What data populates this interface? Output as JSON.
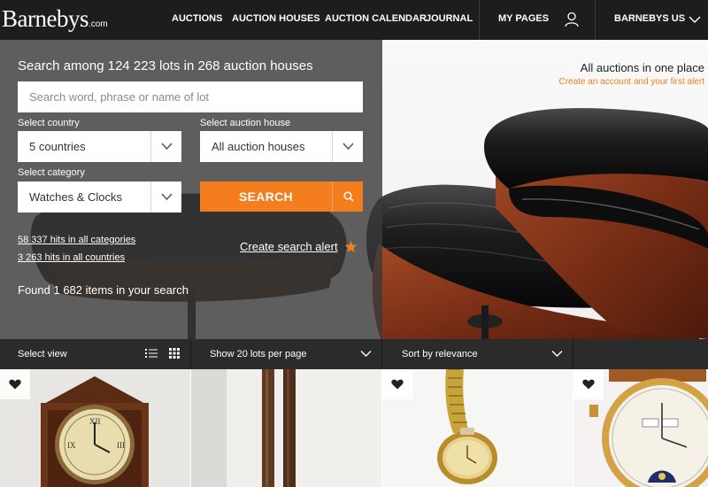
{
  "brand": {
    "name": "Barnebys",
    "suffix": ".com"
  },
  "nav": {
    "auctions": "AUCTIONS",
    "auction_houses": "AUCTION HOUSES",
    "auction_calendar": "AUCTION CALENDAR",
    "journal": "JOURNAL",
    "my_pages": "MY PAGES",
    "region": "BARNEBYS US"
  },
  "search": {
    "headline": "Search among 124 223 lots in 268 auction houses",
    "placeholder": "Search word, phrase or name of lot",
    "country_label": "Select country",
    "country_value": "5 countries",
    "house_label": "Select auction house",
    "house_value": "All auction houses",
    "category_label": "Select category",
    "category_value": "Watches & Clocks",
    "button_label": "SEARCH",
    "hits_all_categories": "58 337 hits in all categories",
    "hits_all_countries": "3 263 hits in all countries",
    "alert_label": "Create search alert",
    "found_text": "Found 1 682 items in your search"
  },
  "promo": {
    "title": "All auctions in one place",
    "subtitle": "Create an account and your first alert"
  },
  "view_bar": {
    "select_view": "Select view",
    "per_page": "Show 20 lots per page",
    "sort": "Sort by relevance"
  },
  "products": [
    {
      "kind": "wall-clock"
    },
    {
      "kind": "pendulum"
    },
    {
      "kind": "omega-gold-watch"
    },
    {
      "kind": "moonphase-watch"
    }
  ],
  "colors": {
    "accent": "#f47e1e",
    "nav_bg": "#1d1d1d",
    "bar_bg": "#2b2b2b"
  }
}
